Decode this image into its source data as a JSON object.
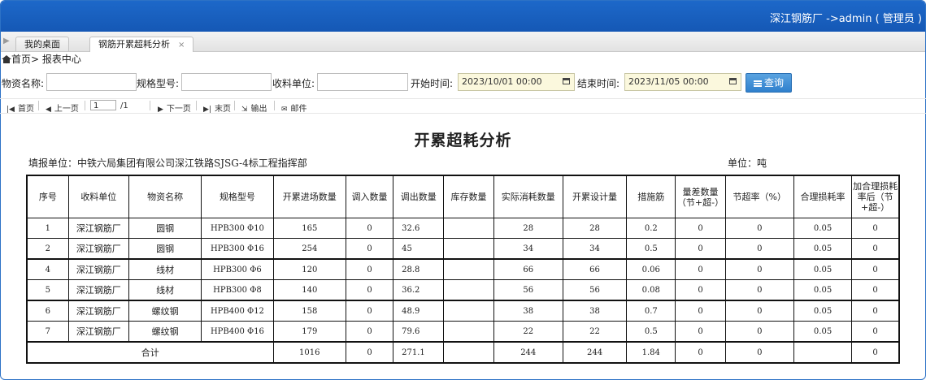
{
  "header": {
    "user_info": "深江钢筋厂 ->admin ( 管理员 )"
  },
  "tabs": [
    {
      "label": "我的桌面"
    },
    {
      "label": "钢筋开累超耗分析",
      "close": "×"
    }
  ],
  "breadcrumb": "首页> 报表中心",
  "filters": {
    "material_name_label": "物资名称:",
    "material_name_value": "",
    "spec_label": "规格型号:",
    "spec_value": "",
    "receiver_label": "收料单位:",
    "receiver_value": "",
    "start_label": "开始时间:",
    "start_value": "2023/10/01 00:00",
    "end_label": "结束时间:",
    "end_value": "2023/11/05 00:00",
    "query_label": "查询"
  },
  "toolbar": {
    "first": "首页",
    "prev": "上一页",
    "page_value": "1",
    "page_total": "/1",
    "next": "下一页",
    "last": "末页",
    "export": "输出",
    "mail": "邮件"
  },
  "report": {
    "title": "开累超耗分析",
    "unit_fill": "填报单位：中铁六局集团有限公司深江铁路SJSG-4标工程指挥部",
    "unit_measure": "单位：吨",
    "headers": [
      "序号",
      "收料单位",
      "物资名称",
      "规格型号",
      "开累进场数量",
      "调入数量",
      "调出数量",
      "库存数量",
      "实际消耗数量",
      "开累设计量",
      "措施筋",
      "量差数量（节+超-）",
      "节超率（%）",
      "合理损耗率",
      "加合理损耗率后（节+超-）"
    ],
    "rows": [
      [
        "1",
        "深江钢筋厂",
        "圆钢",
        "HPB300 Φ10",
        "165",
        "0",
        "32.6",
        "",
        "28",
        "28",
        "0.2",
        "0",
        "0",
        "0.05",
        "0"
      ],
      [
        "2",
        "深江钢筋厂",
        "圆钢",
        "HPB300 Φ16",
        "254",
        "0",
        "45",
        "",
        "34",
        "34",
        "0.5",
        "0",
        "0",
        "0.05",
        "0"
      ],
      [
        "4",
        "深江钢筋厂",
        "线材",
        "HPB300 Φ6",
        "120",
        "0",
        "28.8",
        "",
        "66",
        "66",
        "0.06",
        "0",
        "0",
        "0.05",
        "0"
      ],
      [
        "5",
        "深江钢筋厂",
        "线材",
        "HPB300 Φ8",
        "140",
        "0",
        "36.2",
        "",
        "56",
        "56",
        "0.08",
        "0",
        "0",
        "0.05",
        "0"
      ],
      [
        "6",
        "深江钢筋厂",
        "螺纹钢",
        "HPB400 Φ12",
        "158",
        "0",
        "48.9",
        "",
        "38",
        "38",
        "0.7",
        "0",
        "0",
        "0.05",
        "0"
      ],
      [
        "7",
        "深江钢筋厂",
        "螺纹钢",
        "HPB400 Φ16",
        "179",
        "0",
        "79.6",
        "",
        "22",
        "22",
        "0.5",
        "0",
        "0",
        "0.05",
        "0"
      ]
    ],
    "total": {
      "label": "合计",
      "in_qty": "1016",
      "transfer_in": "0",
      "transfer_out": "271.1",
      "stock": "",
      "actual": "244",
      "design": "244",
      "measure": "1.84",
      "diff": "0",
      "rate": "0",
      "loss": "",
      "after": "0"
    }
  }
}
